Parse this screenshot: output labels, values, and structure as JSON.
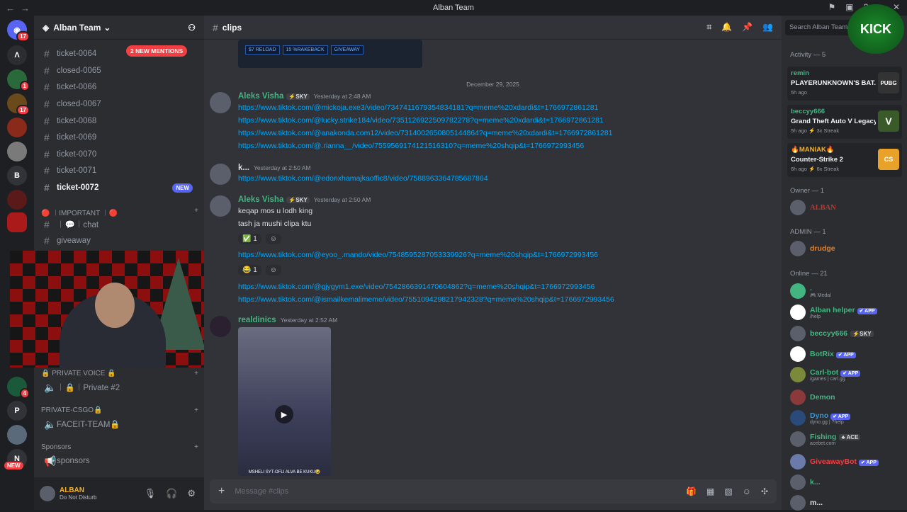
{
  "window": {
    "title": "Alban Team"
  },
  "server": {
    "name": "Alban Team",
    "mentions_label": "2 NEW MENTIONS"
  },
  "guild_badges": [
    "17",
    "1",
    "17",
    "4"
  ],
  "guild_letters": [
    "B",
    "P",
    "N"
  ],
  "guild_new": "NEW",
  "channels": [
    {
      "name": "ticket-0064"
    },
    {
      "name": "closed-0065"
    },
    {
      "name": "ticket-0066"
    },
    {
      "name": "closed-0067"
    },
    {
      "name": "ticket-0068"
    },
    {
      "name": "ticket-0069"
    },
    {
      "name": "ticket-0070"
    },
    {
      "name": "ticket-0071"
    },
    {
      "name": "ticket-0072",
      "badge": "NEW"
    }
  ],
  "categories": {
    "important": "🔴 ︱IMPORTANT ︱🔴",
    "chat": "︱💬︱chat",
    "giveaway": "giveaway",
    "private_voice": "🔒 PRIVATE VOICE 🔒",
    "private2": "︱🔒︱Private #2",
    "private_csgo": "PRIVATE-CSGO🔒",
    "faceit": "FACEIT-TEAM🔒",
    "sponsors_cat": "Sponsors",
    "sponsors": "sponsors"
  },
  "user": {
    "name": "ALBAN",
    "status": "Do Not Disturb"
  },
  "chat": {
    "channel": "clips",
    "embed_buttons": [
      "$7 RELOAD",
      "15 %RAKEBACK",
      "GIVEAWAY"
    ],
    "date_divider": "December 29, 2025",
    "messages": [
      {
        "author": "Aleks Visha",
        "tag": "⚡SKY",
        "time": "Yesterday at 2:48 AM",
        "lines": [
          "https://www.tiktok.com/@mickoja.exe3/video/7347411679354834181?q=meme%20xdardi&t=1766972861281",
          "https://www.tiktok.com/@lucky.strike184/video/7351126922509782278?q=meme%20xdardi&t=1766972861281",
          "https://www.tiktok.com/@anakonda.com12/video/7314002650805144864?q=meme%20xdardi&t=1766972861281",
          "https://www.tiktok.com/@.rianna__/video/7559569174121516310?q=meme%20shqip&t=1766972993456"
        ]
      },
      {
        "author": "k...",
        "time": "Yesterday at 2:50 AM",
        "lines": [
          "https://www.tiktok.com/@edonxhamajkaoffic8/video/7588963364785687864"
        ]
      },
      {
        "author": "Aleks Visha",
        "tag": "⚡SKY",
        "time": "Yesterday at 2:50 AM",
        "text1": "keqap mos u lodh king",
        "text2": "tash ja mushi clipa ktu",
        "react1": "✅",
        "react1_count": "1",
        "link1": "https://www.tiktok.com/@eyoo_.mando/video/7548595287053339926?q=meme%20shqip&t=1766972993456",
        "react2": "😂",
        "react2_count": "1",
        "link2": "https://www.tiktok.com/@gjygym1.exe/video/7542866391470604862?q=meme%20shqip&t=1766972993456",
        "link3": "https://www.tiktok.com/@ismailkemalimeme/video/7551094298217942328?q=meme%20shqip&t=1766972993456"
      },
      {
        "author": "realdinics",
        "time": "Yesterday at 2:52 AM",
        "video_caption": "MSHELI SYT-OFLI ALVA BE KUKU😂"
      }
    ],
    "input_placeholder": "Message #clips"
  },
  "members": {
    "search_placeholder": "Search Alban Team",
    "activity_header": "Activity — 5",
    "activities": [
      {
        "name": "remin",
        "game": "PLAYERUNKNOWN'S BAT...",
        "sub": "5h ago",
        "icon_label": "PUBG"
      },
      {
        "name": "beccyy666",
        "game": "Grand Theft Auto V Legacy",
        "sub": "5h ago  ⚡ 3x Streak",
        "icon_label": "V"
      },
      {
        "name": "🔥MANIAK🔥",
        "game": "Counter-Strike 2",
        "sub": "6h ago  ⚡ 6x Streak",
        "icon_label": "CS"
      }
    ],
    "owner_header": "Owner — 1",
    "owner": "ALBAN",
    "admin_header": "ADMIN — 1",
    "admin": "drudge",
    "online_header": "Online — 21",
    "online": [
      {
        "name": ".",
        "sub": "🎮 Medal",
        "color": "#43b581"
      },
      {
        "name": "Alban helper",
        "tag": "✔ APP",
        "sub": "/help",
        "color": "#43b581"
      },
      {
        "name": "beccyy666",
        "tag": "⚡SKY",
        "color": "#43b581"
      },
      {
        "name": "BotRix",
        "tag": "✔ APP",
        "color": "#43b581"
      },
      {
        "name": "Carl-bot",
        "tag": "✔ APP",
        "sub": "/games | carl.gg",
        "color": "#43b581"
      },
      {
        "name": "Demon",
        "color": "#43b581"
      },
      {
        "name": "Dyno",
        "tag": "✔ APP",
        "sub": "dyno.gg | ?help",
        "color": "#3498db"
      },
      {
        "name": "Fishing",
        "tag": "♣ ACE",
        "sub": "acebet.com",
        "color": "#43b581"
      },
      {
        "name": "GiveawayBot",
        "tag": "✔ APP",
        "color": "#f23f43"
      },
      {
        "name": "k...",
        "color": "#43b581"
      },
      {
        "name": "m...",
        "color": "#dbdee1"
      }
    ]
  },
  "overlay": {
    "logo_text": "KICK"
  }
}
